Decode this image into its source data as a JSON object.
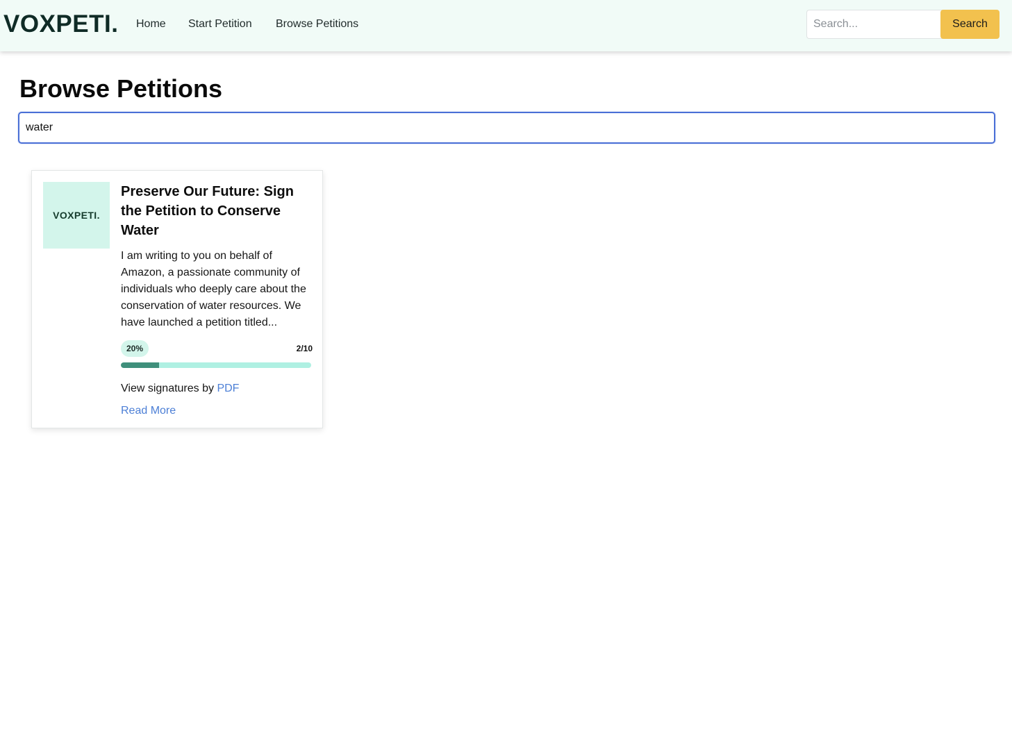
{
  "nav": {
    "brand": "VOXPETI.",
    "links": [
      "Home",
      "Start Petition",
      "Browse Petitions"
    ],
    "search_placeholder": "Search...",
    "search_button": "Search",
    "bg_color": "#f1fbf7",
    "button_color": "#f2c14e"
  },
  "page": {
    "title": "Browse Petitions",
    "filter_value": "water"
  },
  "petitions": [
    {
      "thumb_logo": "VOXPETI.",
      "title": "Preserve Our Future: Sign the Petition to Conserve Water",
      "excerpt": "I am writing to you on behalf of Amazon, a passionate community of individuals who deeply care about the conservation of water resources. We have launched a petition titled...",
      "percent_label": "20%",
      "progress": 0.2,
      "count_label": "2/10",
      "signatures_prefix": "View signatures by ",
      "signatures_link": "PDF",
      "read_more": "Read More",
      "link_color": "#4c7fd6"
    }
  ]
}
